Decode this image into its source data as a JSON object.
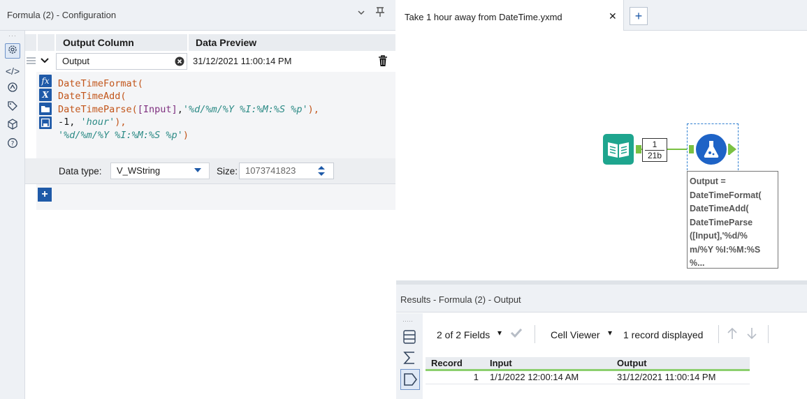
{
  "config": {
    "title": "Formula (2) - Configuration",
    "headers": {
      "output_column": "Output Column",
      "data_preview": "Data Preview"
    },
    "row": {
      "output_name": "Output",
      "preview": "31/12/2021 11:00:14 PM"
    },
    "expression_lines": [
      [
        {
          "t": "DateTimeFormat(",
          "k": "fn"
        }
      ],
      [
        {
          "t": "DateTimeAdd(",
          "k": "fn"
        }
      ],
      [
        {
          "t": "DateTimeParse(",
          "k": "fn"
        },
        {
          "t": "[Input]",
          "k": "fld"
        },
        {
          "t": ",",
          "k": "dflt"
        },
        {
          "t": "'%d/%m/%Y %I:%M:%S %p'",
          "k": "str"
        },
        {
          "t": "),",
          "k": "fn"
        }
      ],
      [
        {
          "t": "-1, ",
          "k": "dflt"
        },
        {
          "t": "'hour'",
          "k": "str"
        },
        {
          "t": "),",
          "k": "fn"
        }
      ],
      [
        {
          "t": "'%d/%m/%Y %I:%M:%S %p'",
          "k": "str"
        },
        {
          "t": ")",
          "k": "fn"
        }
      ]
    ],
    "data_type_label": "Data type:",
    "data_type_value": "V_WString",
    "size_label": "Size:",
    "size_value": "1073741823",
    "add_label": "+"
  },
  "canvas": {
    "tab_label": "Take 1 hour away from DateTime.yxmd",
    "tab_close": "✕",
    "new_tab": "+",
    "connection_count": "1",
    "connection_size": "21b",
    "annotation": [
      "Output =",
      "DateTimeFormat(",
      "DateTimeAdd(",
      "DateTimeParse",
      "([Input],'%d/%",
      "m/%Y %I:%M:%S",
      "%..."
    ]
  },
  "results": {
    "title": "Results - Formula (2) - Output",
    "fields_dropdown": "2 of 2 Fields",
    "cell_viewer": "Cell Viewer",
    "records_displayed": "1 record displayed",
    "columns": [
      "Record",
      "Input",
      "Output"
    ],
    "rows": [
      {
        "record": "1",
        "input": "1/1/2022 12:00:14 AM",
        "output": "31/12/2021 11:00:14 PM"
      }
    ]
  },
  "colors": {
    "accent": "#1f5aa8",
    "tool_green": "#1ea58e",
    "tool_blue": "#1e63c6",
    "connector": "#7ac143"
  }
}
